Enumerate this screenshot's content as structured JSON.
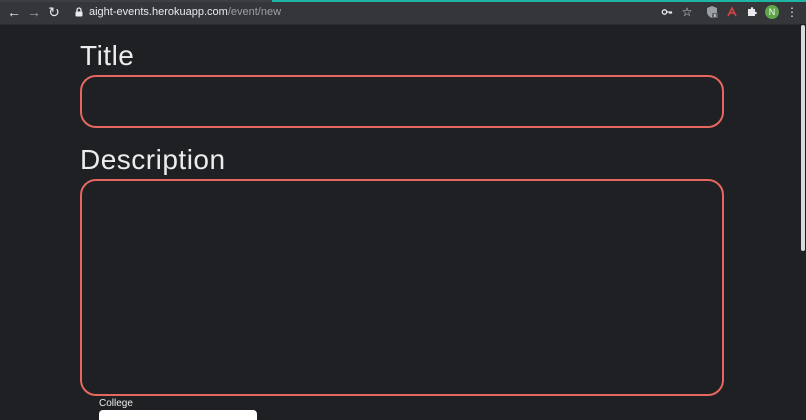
{
  "browser": {
    "url_host": "aight-events.herokuapp.com",
    "url_path": "/event/new",
    "profile_initial": "N",
    "extension_badge": "6"
  },
  "form": {
    "title_label": "Title",
    "title_value": "",
    "description_label": "Description",
    "description_value": "",
    "college_label": "College",
    "college_value": ""
  },
  "colors": {
    "page_bg": "#1e2023",
    "field_border": "#e5675f",
    "toolbar_bg": "#35363a",
    "accent_teal": "#1fb5a4"
  }
}
